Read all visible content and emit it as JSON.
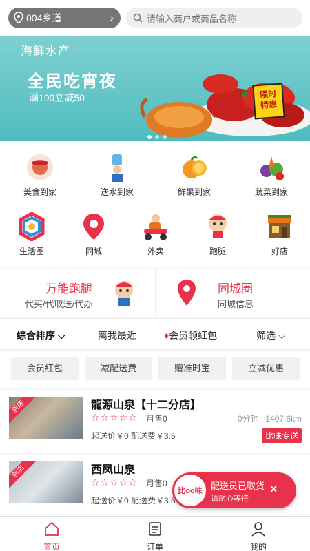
{
  "header": {
    "location": "004乡道",
    "search_placeholder": "请输入商户或商品名称"
  },
  "banner": {
    "tag": "海鲜水产",
    "title": "全民吃宵夜",
    "subtitle": "满199立减50",
    "badge_line1": "限时",
    "badge_line2": "特惠"
  },
  "categories": [
    {
      "label": "美食到家",
      "icon": "food-icon"
    },
    {
      "label": "送水到家",
      "icon": "water-delivery-icon"
    },
    {
      "label": "鲜果到家",
      "icon": "fruit-icon"
    },
    {
      "label": "蔬菜到家",
      "icon": "vegetable-icon"
    },
    {
      "label": "生活圈",
      "icon": "life-circle-icon"
    },
    {
      "label": "同城",
      "icon": "location-pin-icon"
    },
    {
      "label": "外卖",
      "icon": "scooter-icon"
    },
    {
      "label": "跑腿",
      "icon": "runner-icon"
    },
    {
      "label": "好店",
      "icon": "shop-icon"
    }
  ],
  "promo": {
    "left_title": "万能跑腿",
    "left_sub": "代买/代取送/代办",
    "right_title": "同城圈",
    "right_sub": "同城信息"
  },
  "sort": {
    "comprehensive": "综合排序",
    "nearest": "离我最近",
    "member_red_packet": "会员领红包",
    "filter": "筛选"
  },
  "chips": [
    "会员红包",
    "减配送费",
    "赠准时宝",
    "立减优惠"
  ],
  "shops": [
    {
      "name": "龍源山泉【十二分店】",
      "ribbon": "新店",
      "sales": "月售0",
      "distance": "0分钟 | 1407.6km",
      "fee": "起送价￥0  配送费￥3.5",
      "delivery_tag": "比味专送"
    },
    {
      "name": "西凤山泉",
      "ribbon": "新店",
      "sales": "月售0",
      "distance": "",
      "fee": "起送价￥0  配送费￥3.5",
      "delivery_tag": ""
    }
  ],
  "toast": {
    "logo": "比oo味",
    "line1": "配送员已取货",
    "line2": "请耐心等待",
    "close": "×"
  },
  "tabs": [
    {
      "label": "首页",
      "icon": "home-icon"
    },
    {
      "label": "订单",
      "icon": "order-icon"
    },
    {
      "label": "我的",
      "icon": "profile-icon"
    }
  ],
  "colors": {
    "accent": "#e8314a",
    "banner": "#4fbcc0"
  }
}
